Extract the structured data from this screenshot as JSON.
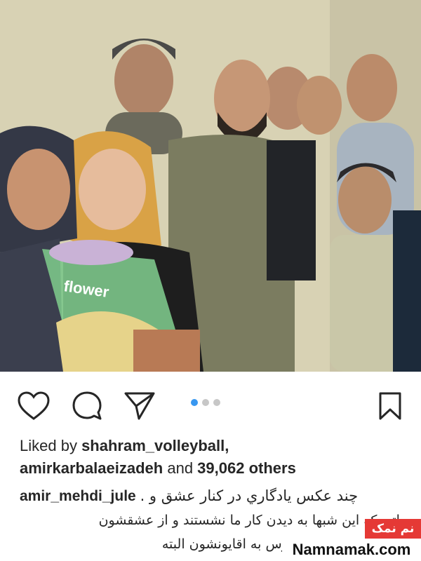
{
  "post": {
    "photo_alt": "group photo",
    "bouquet_text": "flower",
    "carousel": {
      "count": 3,
      "active_index": 0
    }
  },
  "actions": {
    "like_icon": "heart-outline-icon",
    "comment_icon": "comment-bubble-icon",
    "share_icon": "paper-plane-icon",
    "save_icon": "bookmark-outline-icon"
  },
  "likes": {
    "prefix": "Liked by ",
    "user1": "shahram_volleyball",
    "sep": ",",
    "user2": "amirkarbalaeizadeh",
    "mid": " and ",
    "count": "39,062 others"
  },
  "caption": {
    "username": "amir_mehdi_jule",
    "line1": "چند عکس يادگاري در کنار عشق و .",
    "line2": "...اتي که اين شبها به ديدن کار ما نشستند و از عشقشون",
    "line3": "...کردن.بوس بهشون.بوس به اقايونشون البته"
  },
  "watermark": {
    "label_fa": "نم نمک",
    "site": "Namnamak.com"
  },
  "colors": {
    "accent_dot": "#3897f0",
    "inactive_dot": "#c7c7c7",
    "text": "#262626",
    "watermark_red": "#e53935"
  }
}
